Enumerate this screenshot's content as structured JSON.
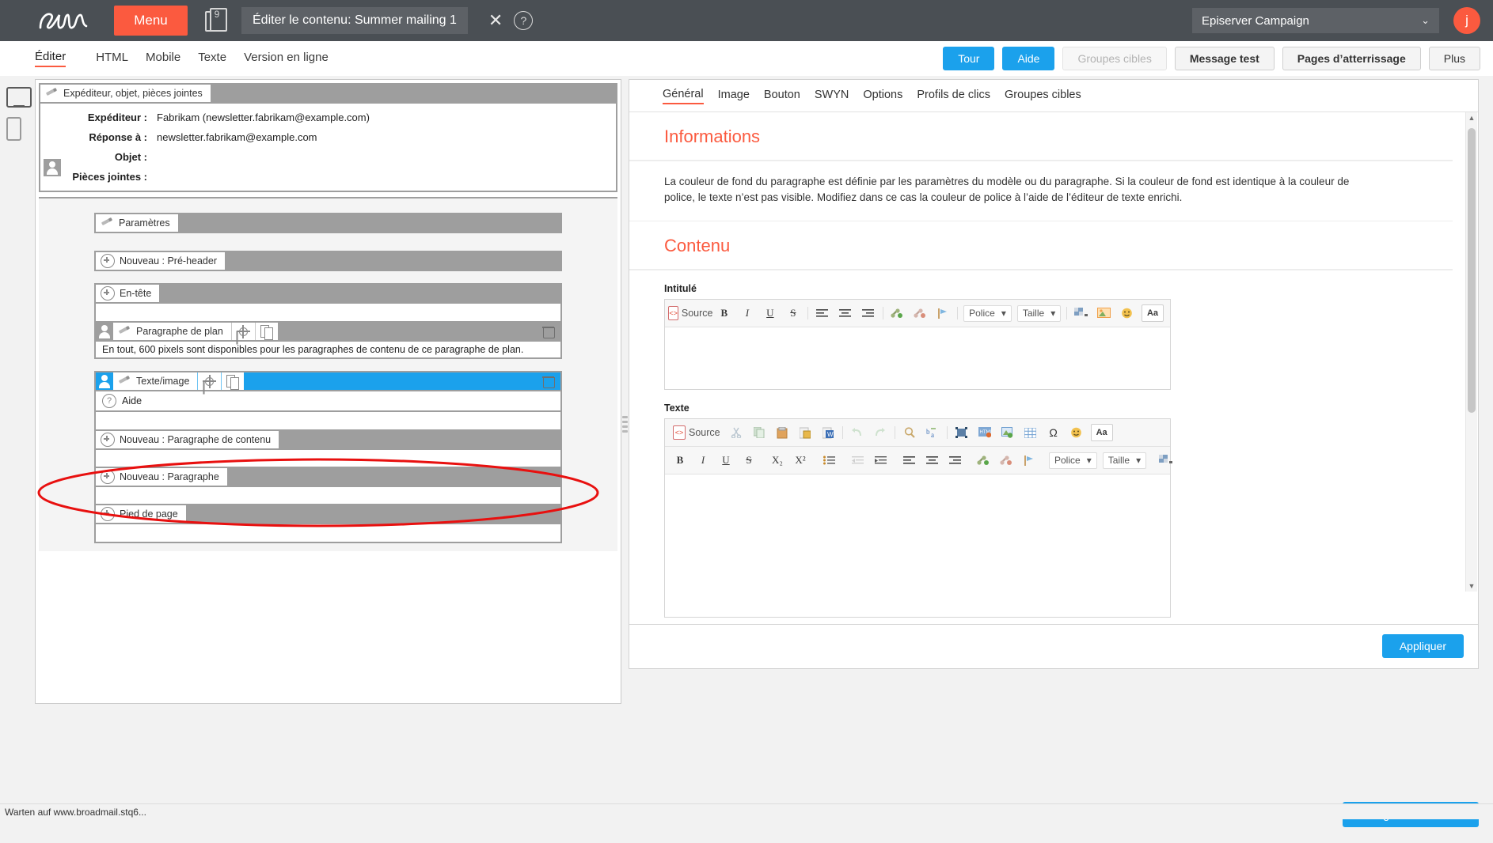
{
  "topbar": {
    "logo": "epi",
    "menu_label": "Menu",
    "doc_badge": "9",
    "title": "Éditer le contenu: Summer mailing 1",
    "close_icon": "✕",
    "help_icon": "?",
    "client_name": "Episerver Campaign",
    "client_chevron": "⌄",
    "avatar_initial": "j",
    "accent_color": "#fb5a3f",
    "bar_color": "#4a4f54"
  },
  "viewtabs": [
    {
      "label": "Éditer",
      "active": true
    },
    {
      "label": "HTML",
      "active": false
    },
    {
      "label": "Mobile",
      "active": false
    },
    {
      "label": "Texte",
      "active": false
    },
    {
      "label": "Version en ligne",
      "active": false
    }
  ],
  "actions": [
    {
      "label": "Tour",
      "style": "blue"
    },
    {
      "label": "Aide",
      "style": "blue"
    },
    {
      "label": "Groupes cibles",
      "style": "disabled"
    },
    {
      "label": "Message test",
      "style": "grey"
    },
    {
      "label": "Pages d’atterrissage",
      "style": "grey"
    },
    {
      "label": "Plus",
      "style": "plain"
    }
  ],
  "devices": [
    {
      "name": "desktop-preview",
      "selected": true
    },
    {
      "name": "mobile-preview",
      "selected": false
    }
  ],
  "preview": {
    "sender_bar_label": "Expéditeur, objet, pièces jointes",
    "fields": [
      {
        "label": "Expéditeur :",
        "value": "Fabrikam (newsletter.fabrikam@example.com)"
      },
      {
        "label": "Réponse à :",
        "value": "newsletter.fabrikam@example.com"
      },
      {
        "label": "Objet :",
        "value": ""
      },
      {
        "label": "Pièces jointes :",
        "value": ""
      }
    ],
    "rows": [
      {
        "label": "Paramètres",
        "icon": "pencil-icon",
        "type": "settings"
      },
      {
        "label": "Nouveau : Pré-header",
        "icon": "plus-icon",
        "type": "new"
      },
      {
        "label": "En-tête",
        "icon": "plus-icon",
        "type": "new"
      }
    ],
    "plan_row": {
      "label": "Paragraphe de plan",
      "note": "En tout, 600 pixels sont disponibles pour les paragraphes de contenu de ce paragraphe de plan."
    },
    "selected_row": {
      "label": "Texte/image",
      "help_label": "Aide",
      "highlight_color": "#1ba1ec"
    },
    "rows_after": [
      {
        "label": "Nouveau : Paragraphe de contenu",
        "icon": "plus-icon"
      },
      {
        "label": "Nouveau : Paragraphe",
        "icon": "plus-icon"
      },
      {
        "label": "Pied de page",
        "icon": "plus-icon"
      }
    ]
  },
  "right_panel": {
    "tabs": [
      {
        "label": "Général",
        "active": true
      },
      {
        "label": "Image",
        "active": false
      },
      {
        "label": "Bouton",
        "active": false
      },
      {
        "label": "SWYN",
        "active": false
      },
      {
        "label": "Options",
        "active": false
      },
      {
        "label": "Profils de clics",
        "active": false
      },
      {
        "label": "Groupes cibles",
        "active": false
      }
    ],
    "info_heading": "Informations",
    "info_body": "La couleur de fond du paragraphe est définie par les paramètres du modèle ou du paragraphe. Si la couleur de fond est identique à la couleur de police, le texte n’est pas visible. Modifiez dans ce cas la couleur de police à l’aide de l’éditeur de texte enrichi.",
    "content_heading": "Contenu",
    "title_field": {
      "label": "Intitulé",
      "value": "",
      "toolbar": {
        "source": "Source",
        "bold": "B",
        "italic": "I",
        "underline": "U",
        "strike": "S",
        "align_left": "align-left-icon",
        "align_center": "align-center-icon",
        "align_right": "align-right-icon",
        "link": "link-icon",
        "unlink": "unlink-icon",
        "anchor": "anchor-icon",
        "font_label": "Police",
        "size_label": "Taille",
        "color_label": "text-color-icon",
        "image": "image-icon",
        "smiley": "smiley-icon",
        "special": "Aa"
      }
    },
    "text_field": {
      "label": "Texte",
      "value": "",
      "toolbar_row1": {
        "source": "Source",
        "cut": "cut-icon",
        "copy": "copy-icon",
        "paste": "paste-icon",
        "paste_text": "paste-text-icon",
        "paste_word": "paste-word-icon",
        "undo": "undo-icon",
        "redo": "redo-icon",
        "find": "find-icon",
        "replace": "replace-icon",
        "select_all": "select-all-icon",
        "html_block": "html-block-icon",
        "image": "image-icon",
        "table": "table-icon",
        "omega": "Ω",
        "smiley": "smiley-icon",
        "special": "Aa"
      },
      "toolbar_row2": {
        "bold": "B",
        "italic": "I",
        "underline": "U",
        "strike": "S",
        "subscript": "X₂",
        "superscript": "X²",
        "list": "list-icon",
        "outdent": "outdent-icon",
        "indent": "indent-icon",
        "align_left": "align-left-icon",
        "align_center": "align-center-icon",
        "align_right": "align-right-icon",
        "link": "link-icon",
        "unlink": "unlink-icon",
        "anchor": "anchor-icon",
        "font_label": "Police",
        "size_label": "Taille",
        "color_label": "text-color-icon"
      }
    },
    "apply_label": "Appliquer"
  },
  "footer": {
    "save_label": "Enregistrer et fermer",
    "status_text": "Warten auf www.broadmail.stq6..."
  },
  "annotation": {
    "shape": "ellipse",
    "color": "#e8100f"
  }
}
